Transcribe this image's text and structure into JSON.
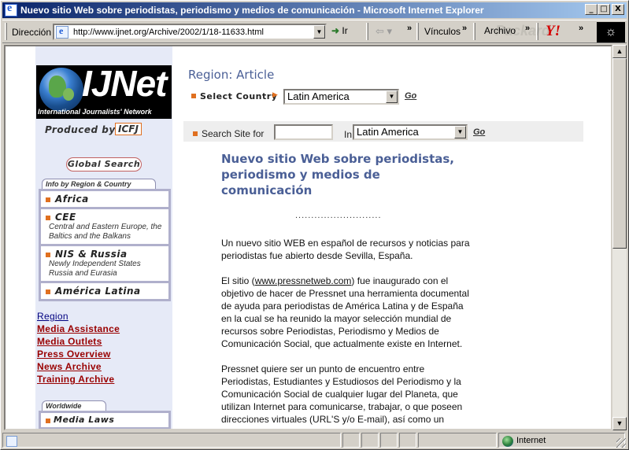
{
  "window": {
    "title": "Nuevo sitio Web sobre periodistas, periodismo y medios de comunicación - Microsoft Internet Explorer",
    "min": "_",
    "max": "□",
    "close": "X"
  },
  "toolbar": {
    "address_label": "Dirección",
    "url": "http://www.ijnet.org/Archive/2002/1/18-11633.html",
    "go_label": "Ir",
    "links_label": "Vínculos",
    "archivo_label": "Archivo",
    "chevron": "»"
  },
  "status": {
    "zone": "Internet"
  },
  "sidebar": {
    "logo_text": "IJNet",
    "logo_sub": "International Journalists' Network",
    "produced_by": "Produced by",
    "producer": "ICFJ",
    "global_search": "Global Search",
    "region_tab": "Info by Region & Country",
    "regions": [
      {
        "title": "Africa",
        "sub": ""
      },
      {
        "title": "CEE",
        "sub": "Central and Eastern Europe, the Baltics and the Balkans"
      },
      {
        "title": "NIS & Russia",
        "sub": "Newly Independent States Russia and Eurasia"
      },
      {
        "title": "América Latina",
        "sub": ""
      }
    ],
    "links": [
      "Region",
      "Media Assistance",
      "Media Outlets",
      "Press Overview",
      "News Archive",
      "Training Archive"
    ],
    "worldwide_tab": "Worldwide",
    "media_laws": "Media Laws"
  },
  "main": {
    "region_heading": "Region: Article",
    "select_country_label": "Select Country",
    "country_value": "Latin America",
    "go": "Go",
    "search_label": "Search Site for",
    "search_value": "",
    "in_label": "In",
    "search_scope": "Latin America",
    "article_title": "Nuevo sitio Web sobre periodistas, periodismo y medios de comunicación",
    "separator": "...........................",
    "p1": "Un nuevo sitio WEB en español de recursos y noticias para periodistas fue abierto desde Sevilla, España.",
    "p2_pre": "El sitio (",
    "p2_link": "www.pressnetweb.com",
    "p2_post": ") fue inaugurado con el objetivo de hacer de Pressnet una herramienta documental de ayuda para periodistas de América Latina y de España en la cual se ha reunido la mayor selección mundial de recursos sobre Periodistas, Periodismo y Medios de Comunicación Social, que actualmente existe en Internet.",
    "p3": "Pressnet quiere ser un punto de encuentro entre Periodistas, Estudiantes y Estudiosos del Periodismo y la Comunicación Social de cualquier lugar del Planeta, que utilizan Internet para comunicarse, trabajar, o que poseen direcciones virtuales (URL'S y/o E-mail), así como un"
  },
  "colors": {
    "titlebar_start": "#0a246a",
    "heading_blue": "#4a5f96",
    "link_red": "#990000",
    "accent_orange": "#e07020",
    "sidebar_bg": "#e6eaf7"
  }
}
